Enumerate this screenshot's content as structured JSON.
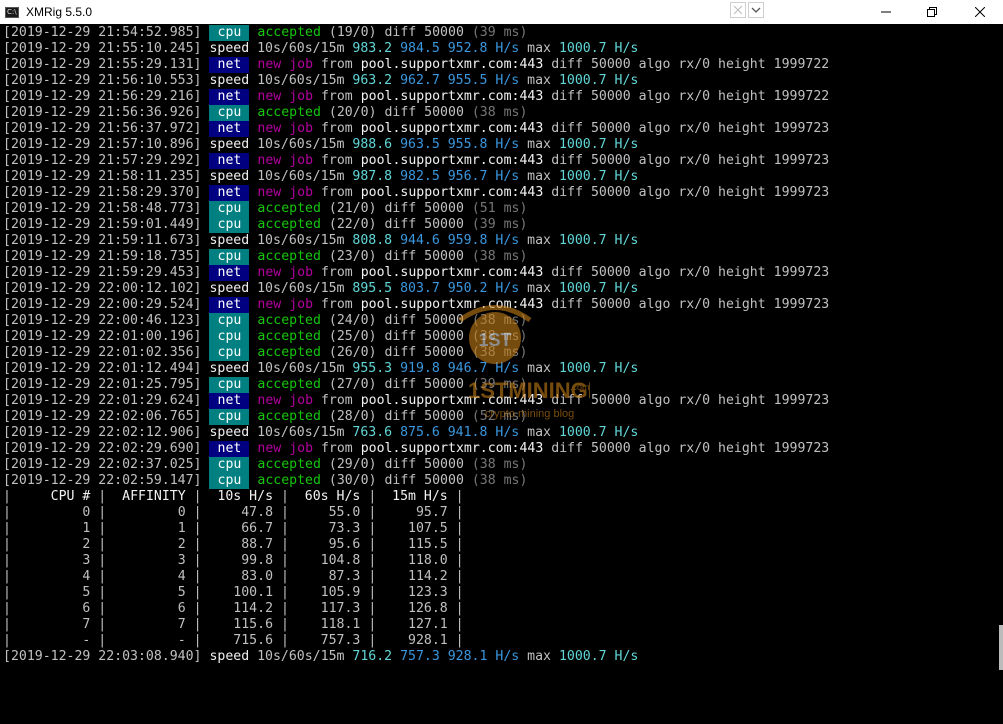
{
  "window": {
    "title": "XMRig 5.5.0",
    "app_icon_text": "C:\\"
  },
  "terminal": {
    "lines": [
      {
        "kind": "accepted",
        "ts": "[2019-12-29 21:54:52.985]",
        "tag": "cpu",
        "word": "accepted",
        "count": "(19/0)",
        "diff": "diff 50000",
        "ms": "(39 ms)"
      },
      {
        "kind": "speed",
        "ts": "[2019-12-29 21:55:10.245]",
        "label": "speed",
        "cols": "10s/60s/15m",
        "v10": "983.2",
        "v60": "984.5",
        "v15": "952.8",
        "unit": "H/s",
        "max": "max",
        "maxv": "1000.7",
        "maxunit": "H/s"
      },
      {
        "kind": "job",
        "ts": "[2019-12-29 21:55:29.131]",
        "tag": "net",
        "w1": "new",
        "w2": "job",
        "from": "from",
        "pool": "pool.supportxmr.com:443",
        "diff": "diff 50000",
        "algo": "algo rx/0",
        "height": "height 1999722"
      },
      {
        "kind": "speed",
        "ts": "[2019-12-29 21:56:10.553]",
        "label": "speed",
        "cols": "10s/60s/15m",
        "v10": "963.2",
        "v60": "962.7",
        "v15": "955.5",
        "unit": "H/s",
        "max": "max",
        "maxv": "1000.7",
        "maxunit": "H/s"
      },
      {
        "kind": "job",
        "ts": "[2019-12-29 21:56:29.216]",
        "tag": "net",
        "w1": "new",
        "w2": "job",
        "from": "from",
        "pool": "pool.supportxmr.com:443",
        "diff": "diff 50000",
        "algo": "algo rx/0",
        "height": "height 1999722"
      },
      {
        "kind": "accepted",
        "ts": "[2019-12-29 21:56:36.926]",
        "tag": "cpu",
        "word": "accepted",
        "count": "(20/0)",
        "diff": "diff 50000",
        "ms": "(38 ms)"
      },
      {
        "kind": "job",
        "ts": "[2019-12-29 21:56:37.972]",
        "tag": "net",
        "w1": "new",
        "w2": "job",
        "from": "from",
        "pool": "pool.supportxmr.com:443",
        "diff": "diff 50000",
        "algo": "algo rx/0",
        "height": "height 1999723"
      },
      {
        "kind": "speed",
        "ts": "[2019-12-29 21:57:10.896]",
        "label": "speed",
        "cols": "10s/60s/15m",
        "v10": "988.6",
        "v60": "963.5",
        "v15": "955.8",
        "unit": "H/s",
        "max": "max",
        "maxv": "1000.7",
        "maxunit": "H/s"
      },
      {
        "kind": "job",
        "ts": "[2019-12-29 21:57:29.292]",
        "tag": "net",
        "w1": "new",
        "w2": "job",
        "from": "from",
        "pool": "pool.supportxmr.com:443",
        "diff": "diff 50000",
        "algo": "algo rx/0",
        "height": "height 1999723"
      },
      {
        "kind": "speed",
        "ts": "[2019-12-29 21:58:11.235]",
        "label": "speed",
        "cols": "10s/60s/15m",
        "v10": "987.8",
        "v60": "982.5",
        "v15": "956.7",
        "unit": "H/s",
        "max": "max",
        "maxv": "1000.7",
        "maxunit": "H/s"
      },
      {
        "kind": "job",
        "ts": "[2019-12-29 21:58:29.370]",
        "tag": "net",
        "w1": "new",
        "w2": "job",
        "from": "from",
        "pool": "pool.supportxmr.com:443",
        "diff": "diff 50000",
        "algo": "algo rx/0",
        "height": "height 1999723"
      },
      {
        "kind": "accepted",
        "ts": "[2019-12-29 21:58:48.773]",
        "tag": "cpu",
        "word": "accepted",
        "count": "(21/0)",
        "diff": "diff 50000",
        "ms": "(51 ms)"
      },
      {
        "kind": "accepted",
        "ts": "[2019-12-29 21:59:01.449]",
        "tag": "cpu",
        "word": "accepted",
        "count": "(22/0)",
        "diff": "diff 50000",
        "ms": "(39 ms)"
      },
      {
        "kind": "speed",
        "ts": "[2019-12-29 21:59:11.673]",
        "label": "speed",
        "cols": "10s/60s/15m",
        "v10": "808.8",
        "v60": "944.6",
        "v15": "959.8",
        "unit": "H/s",
        "max": "max",
        "maxv": "1000.7",
        "maxunit": "H/s"
      },
      {
        "kind": "accepted",
        "ts": "[2019-12-29 21:59:18.735]",
        "tag": "cpu",
        "word": "accepted",
        "count": "(23/0)",
        "diff": "diff 50000",
        "ms": "(38 ms)"
      },
      {
        "kind": "job",
        "ts": "[2019-12-29 21:59:29.453]",
        "tag": "net",
        "w1": "new",
        "w2": "job",
        "from": "from",
        "pool": "pool.supportxmr.com:443",
        "diff": "diff 50000",
        "algo": "algo rx/0",
        "height": "height 1999723"
      },
      {
        "kind": "speed",
        "ts": "[2019-12-29 22:00:12.102]",
        "label": "speed",
        "cols": "10s/60s/15m",
        "v10": "895.5",
        "v60": "803.7",
        "v15": "950.2",
        "unit": "H/s",
        "max": "max",
        "maxv": "1000.7",
        "maxunit": "H/s"
      },
      {
        "kind": "job",
        "ts": "[2019-12-29 22:00:29.524]",
        "tag": "net",
        "w1": "new",
        "w2": "job",
        "from": "from",
        "pool": "pool.supportxmr.com:443",
        "diff": "diff 50000",
        "algo": "algo rx/0",
        "height": "height 1999723"
      },
      {
        "kind": "accepted",
        "ts": "[2019-12-29 22:00:46.123]",
        "tag": "cpu",
        "word": "accepted",
        "count": "(24/0)",
        "diff": "diff 50000",
        "ms": "(38 ms)"
      },
      {
        "kind": "accepted",
        "ts": "[2019-12-29 22:01:00.196]",
        "tag": "cpu",
        "word": "accepted",
        "count": "(25/0)",
        "diff": "diff 50000",
        "ms": "(38 ms)"
      },
      {
        "kind": "accepted",
        "ts": "[2019-12-29 22:01:02.356]",
        "tag": "cpu",
        "word": "accepted",
        "count": "(26/0)",
        "diff": "diff 50000",
        "ms": "(38 ms)"
      },
      {
        "kind": "speed",
        "ts": "[2019-12-29 22:01:12.494]",
        "label": "speed",
        "cols": "10s/60s/15m",
        "v10": "955.3",
        "v60": "919.8",
        "v15": "946.7",
        "unit": "H/s",
        "max": "max",
        "maxv": "1000.7",
        "maxunit": "H/s"
      },
      {
        "kind": "accepted",
        "ts": "[2019-12-29 22:01:25.795]",
        "tag": "cpu",
        "word": "accepted",
        "count": "(27/0)",
        "diff": "diff 50000",
        "ms": "(39 ms)"
      },
      {
        "kind": "job",
        "ts": "[2019-12-29 22:01:29.624]",
        "tag": "net",
        "w1": "new",
        "w2": "job",
        "from": "from",
        "pool": "pool.supportxmr.com:443",
        "diff": "diff 50000",
        "algo": "algo rx/0",
        "height": "height 1999723"
      },
      {
        "kind": "accepted",
        "ts": "[2019-12-29 22:02:06.765]",
        "tag": "cpu",
        "word": "accepted",
        "count": "(28/0)",
        "diff": "diff 50000",
        "ms": "(52 ms)"
      },
      {
        "kind": "speed",
        "ts": "[2019-12-29 22:02:12.906]",
        "label": "speed",
        "cols": "10s/60s/15m",
        "v10": "763.6",
        "v60": "875.6",
        "v15": "941.8",
        "unit": "H/s",
        "max": "max",
        "maxv": "1000.7",
        "maxunit": "H/s"
      },
      {
        "kind": "job",
        "ts": "[2019-12-29 22:02:29.690]",
        "tag": "net",
        "w1": "new",
        "w2": "job",
        "from": "from",
        "pool": "pool.supportxmr.com:443",
        "diff": "diff 50000",
        "algo": "algo rx/0",
        "height": "height 1999723"
      },
      {
        "kind": "accepted",
        "ts": "[2019-12-29 22:02:37.025]",
        "tag": "cpu",
        "word": "accepted",
        "count": "(29/0)",
        "diff": "diff 50000",
        "ms": "(38 ms)"
      },
      {
        "kind": "accepted",
        "ts": "[2019-12-29 22:02:59.147]",
        "tag": "cpu",
        "word": "accepted",
        "count": "(30/0)",
        "diff": "diff 50000",
        "ms": "(38 ms)"
      }
    ],
    "table": {
      "headers": [
        "CPU #",
        "AFFINITY",
        "10s H/s",
        "60s H/s",
        "15m H/s"
      ],
      "rows": [
        [
          "0",
          "0",
          "47.8",
          "55.0",
          "95.7"
        ],
        [
          "1",
          "1",
          "66.7",
          "73.3",
          "107.5"
        ],
        [
          "2",
          "2",
          "88.7",
          "95.6",
          "115.5"
        ],
        [
          "3",
          "3",
          "99.8",
          "104.8",
          "118.0"
        ],
        [
          "4",
          "4",
          "83.0",
          "87.3",
          "114.2"
        ],
        [
          "5",
          "5",
          "100.1",
          "105.9",
          "123.3"
        ],
        [
          "6",
          "6",
          "114.2",
          "117.3",
          "126.8"
        ],
        [
          "7",
          "7",
          "115.6",
          "118.1",
          "127.1"
        ],
        [
          "-",
          "-",
          "715.6",
          "757.3",
          "928.1"
        ]
      ]
    },
    "final_line": {
      "ts": "[2019-12-29 22:03:08.940]",
      "label": "speed",
      "cols": "10s/60s/15m",
      "v10": "716.2",
      "v60": "757.3",
      "v15": "928.1",
      "unit": "H/s",
      "max": "max",
      "maxv": "1000.7",
      "maxunit": "H/s"
    }
  },
  "watermark": {
    "text": "1STMININGRIG",
    "sub": "crypto mining blog",
    "badge": "1ST",
    "dotcom": ".com"
  },
  "colors": {
    "cpu_tag": "#008080",
    "net_tag": "#000080",
    "green": "#16c60c",
    "magenta": "#b4009e",
    "cyan": "#61d6d6",
    "teal": "#3a96dd",
    "gray": "#767676"
  }
}
